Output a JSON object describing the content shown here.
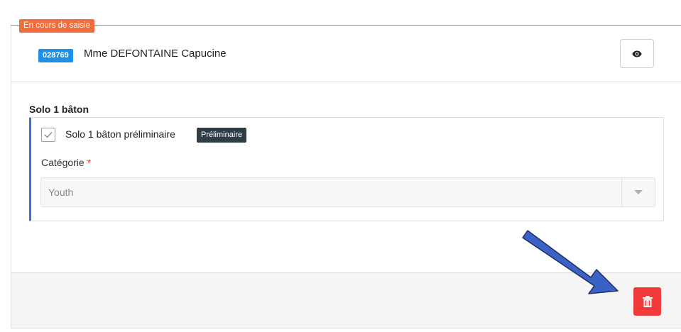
{
  "status_tag": "En cours de saisie",
  "header": {
    "id_badge": "028769",
    "person_name": "Mme DEFONTAINE Capucine",
    "view_icon": "eye-icon"
  },
  "section": {
    "title": "Solo 1 bâton",
    "checkbox_label": "Solo 1 bâton préliminaire",
    "checkbox_checked": true,
    "badge": "Préliminaire",
    "category_label": "Catégorie",
    "required_marker": "*",
    "category_value": "Youth"
  },
  "footer": {
    "delete_icon": "trash-icon"
  },
  "colors": {
    "status_tag": "#f26b3a",
    "id_badge": "#1e8fe6",
    "accent_border": "#3a6fd8",
    "delete_button": "#f23a3a",
    "annotation_arrow": "#3a62c4",
    "divider_green": "#4caf50"
  }
}
